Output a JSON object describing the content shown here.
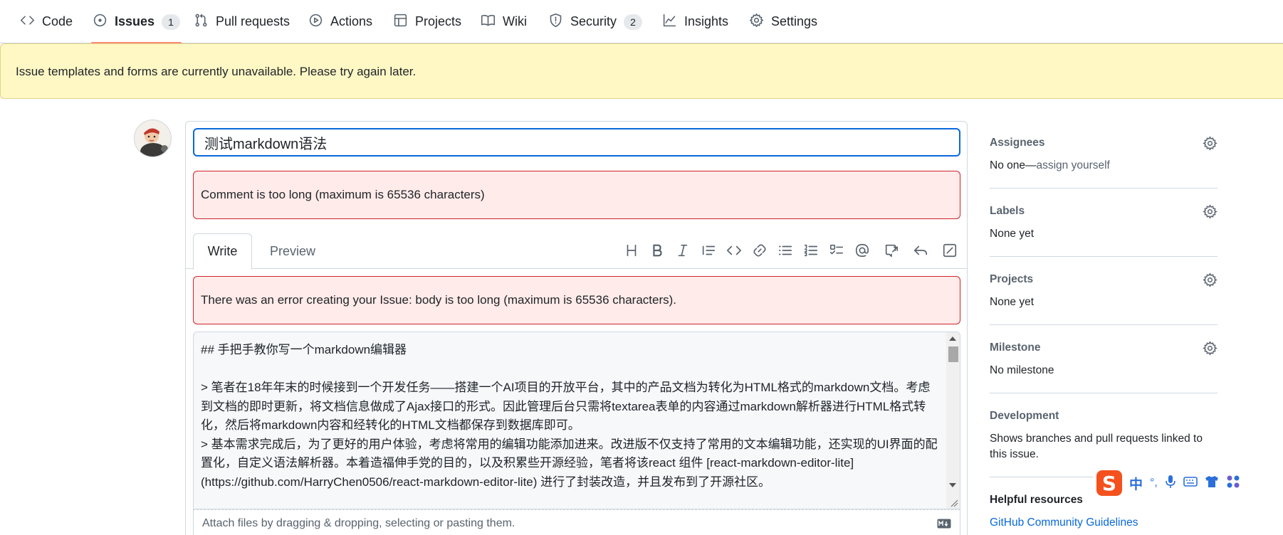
{
  "nav": {
    "tabs": [
      {
        "label": "Code",
        "icon": "code-icon"
      },
      {
        "label": "Issues",
        "icon": "issue-opened-icon",
        "count": "1",
        "active": true
      },
      {
        "label": "Pull requests",
        "icon": "git-pull-request-icon"
      },
      {
        "label": "Actions",
        "icon": "play-icon"
      },
      {
        "label": "Projects",
        "icon": "table-icon"
      },
      {
        "label": "Wiki",
        "icon": "book-icon"
      },
      {
        "label": "Security",
        "icon": "shield-icon",
        "count": "2"
      },
      {
        "label": "Insights",
        "icon": "graph-icon"
      },
      {
        "label": "Settings",
        "icon": "gear-icon"
      }
    ]
  },
  "flash": {
    "message": "Issue templates and forms are currently unavailable. Please try again later.",
    "color": "#fff8c5"
  },
  "form": {
    "title_value": "测试markdown语法",
    "error_comment": "Comment is too long (maximum is 65536 characters)",
    "tab_write": "Write",
    "tab_preview": "Preview",
    "error_create": "There was an error creating your Issue: body is too long (maximum is 65536 characters).",
    "body_text": "## 手把手教你写一个markdown编辑器\n\n> 笔者在18年年末的时候接到一个开发任务——搭建一个AI项目的开放平台，其中的产品文档为转化为HTML格式的markdown文档。考虑到文档的即时更新，将文档信息做成了Ajax接口的形式。因此管理后台只需将textarea表单的内容通过markdown解析器进行HTML格式转化，然后将markdown内容和经转化的HTML文档都保存到数据库即可。\n> 基本需求完成后，为了更好的用户体验，考虑将常用的编辑功能添加进来。改进版不仅支持了常用的文本编辑功能，还实现的UI界面的配置化，自定义语法解析器。本着造福伸手党的目的，以及积累些开源经验，笔者将该react 组件 [react-markdown-editor-lite](https://github.com/HarryChen0506/react-markdown-editor-lite) 进行了封装改造，并且发布到了开源社区。",
    "attach_hint": "Attach files by dragging & dropping, selecting or pasting them.",
    "toolbar": [
      "heading-icon",
      "bold-icon",
      "italic-icon",
      "quote-icon",
      "code-icon",
      "link-icon",
      "unordered-list-icon",
      "ordered-list-icon",
      "tasklist-icon",
      "mention-icon",
      "cross-reference-icon",
      "reply-icon",
      "fullscreen-icon"
    ]
  },
  "sidebar": {
    "assignees": {
      "heading": "Assignees",
      "value": "No one—",
      "link": "assign yourself"
    },
    "labels": {
      "heading": "Labels",
      "value": "None yet"
    },
    "projects": {
      "heading": "Projects",
      "value": "None yet"
    },
    "milestone": {
      "heading": "Milestone",
      "value": "No milestone"
    },
    "development": {
      "heading": "Development",
      "text": "Shows branches and pull requests linked to this issue."
    },
    "helpful": {
      "heading": "Helpful resources",
      "link": "GitHub Community Guidelines"
    }
  },
  "ime": {
    "logo": "S",
    "mode": "中",
    "punct": "°,"
  }
}
